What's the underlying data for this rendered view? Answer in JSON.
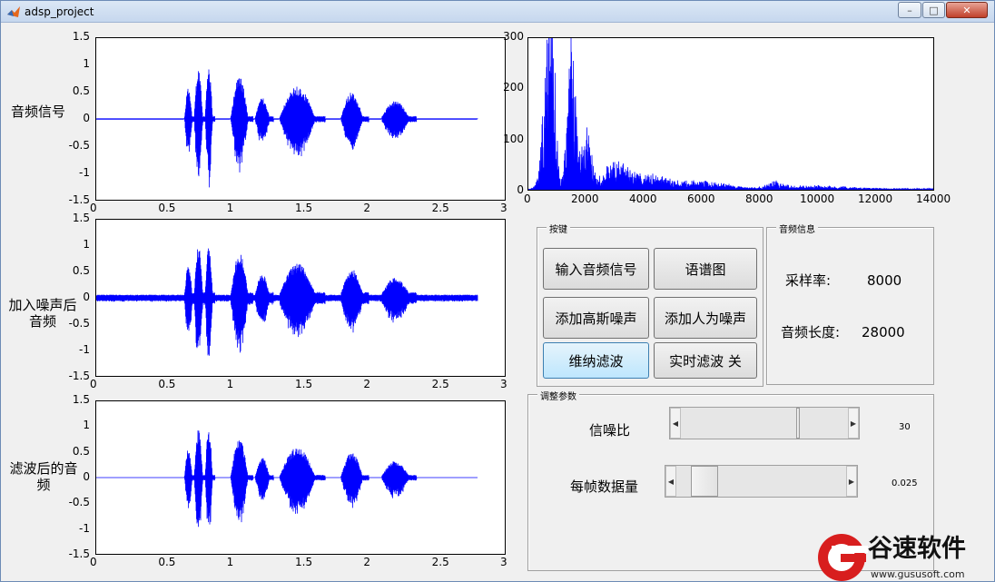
{
  "window": {
    "title": "adsp_project",
    "minimize": "–",
    "maximize": "□",
    "close": "✕"
  },
  "plots": {
    "signal_label": "音频信号",
    "noisy_label_line1": "加入噪声后",
    "noisy_label_line2": "音频",
    "filtered_label_line1": "滤波后的音",
    "filtered_label_line2": "频",
    "y_ticks": [
      "1.5",
      "1",
      "0.5",
      "0",
      "-0.5",
      "-1",
      "-1.5"
    ],
    "x_ticks": [
      "0",
      "0.5",
      "1",
      "1.5",
      "2",
      "2.5",
      "3"
    ]
  },
  "spectrum": {
    "y_ticks": [
      "300",
      "200",
      "100",
      "0"
    ],
    "x_ticks": [
      "0",
      "2000",
      "4000",
      "6000",
      "8000",
      "10000",
      "12000",
      "14000"
    ]
  },
  "buttons_panel": {
    "title": "按键",
    "input_audio": "输入音频信号",
    "spectrogram": "语谱图",
    "add_gaussian": "添加高斯噪声",
    "add_human": "添加人为噪声",
    "wiener": "维纳滤波",
    "realtime": "实时滤波 关"
  },
  "info_panel": {
    "title": "音频信息",
    "sample_rate_label": "采样率:",
    "sample_rate_value": "8000",
    "length_label": "音频长度:",
    "length_value": "28000"
  },
  "params_panel": {
    "title": "调整参数",
    "snr_label": "信噪比",
    "snr_value": "30",
    "snr_level": 0.7,
    "frame_label": "每帧数据量",
    "frame_value": "0.025",
    "frame_level": 0.1
  },
  "watermark": {
    "text": "谷速软件",
    "url": "www.gususoft.com"
  },
  "colors": {
    "signal": "#0000ff",
    "axes_bg": "#ffffff",
    "figure_bg": "#f0f0f0"
  }
}
